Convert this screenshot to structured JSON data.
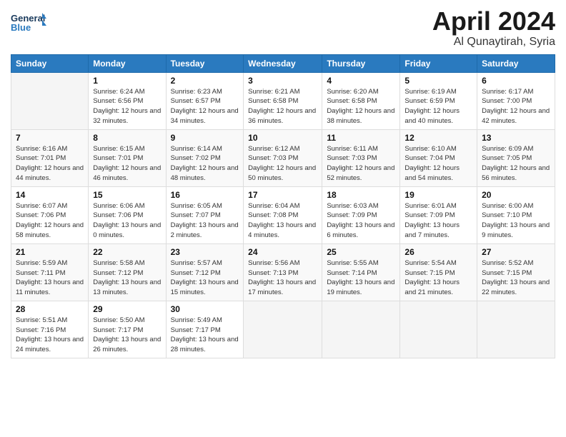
{
  "header": {
    "logo_line1": "General",
    "logo_line2": "Blue",
    "month_title": "April 2024",
    "location": "Al Qunaytirah, Syria"
  },
  "days_of_week": [
    "Sunday",
    "Monday",
    "Tuesday",
    "Wednesday",
    "Thursday",
    "Friday",
    "Saturday"
  ],
  "weeks": [
    [
      null,
      {
        "num": "1",
        "sunrise": "6:24 AM",
        "sunset": "6:56 PM",
        "daylight": "12 hours and 32 minutes."
      },
      {
        "num": "2",
        "sunrise": "6:23 AM",
        "sunset": "6:57 PM",
        "daylight": "12 hours and 34 minutes."
      },
      {
        "num": "3",
        "sunrise": "6:21 AM",
        "sunset": "6:58 PM",
        "daylight": "12 hours and 36 minutes."
      },
      {
        "num": "4",
        "sunrise": "6:20 AM",
        "sunset": "6:58 PM",
        "daylight": "12 hours and 38 minutes."
      },
      {
        "num": "5",
        "sunrise": "6:19 AM",
        "sunset": "6:59 PM",
        "daylight": "12 hours and 40 minutes."
      },
      {
        "num": "6",
        "sunrise": "6:17 AM",
        "sunset": "7:00 PM",
        "daylight": "12 hours and 42 minutes."
      }
    ],
    [
      {
        "num": "7",
        "sunrise": "6:16 AM",
        "sunset": "7:01 PM",
        "daylight": "12 hours and 44 minutes."
      },
      {
        "num": "8",
        "sunrise": "6:15 AM",
        "sunset": "7:01 PM",
        "daylight": "12 hours and 46 minutes."
      },
      {
        "num": "9",
        "sunrise": "6:14 AM",
        "sunset": "7:02 PM",
        "daylight": "12 hours and 48 minutes."
      },
      {
        "num": "10",
        "sunrise": "6:12 AM",
        "sunset": "7:03 PM",
        "daylight": "12 hours and 50 minutes."
      },
      {
        "num": "11",
        "sunrise": "6:11 AM",
        "sunset": "7:03 PM",
        "daylight": "12 hours and 52 minutes."
      },
      {
        "num": "12",
        "sunrise": "6:10 AM",
        "sunset": "7:04 PM",
        "daylight": "12 hours and 54 minutes."
      },
      {
        "num": "13",
        "sunrise": "6:09 AM",
        "sunset": "7:05 PM",
        "daylight": "12 hours and 56 minutes."
      }
    ],
    [
      {
        "num": "14",
        "sunrise": "6:07 AM",
        "sunset": "7:06 PM",
        "daylight": "12 hours and 58 minutes."
      },
      {
        "num": "15",
        "sunrise": "6:06 AM",
        "sunset": "7:06 PM",
        "daylight": "13 hours and 0 minutes."
      },
      {
        "num": "16",
        "sunrise": "6:05 AM",
        "sunset": "7:07 PM",
        "daylight": "13 hours and 2 minutes."
      },
      {
        "num": "17",
        "sunrise": "6:04 AM",
        "sunset": "7:08 PM",
        "daylight": "13 hours and 4 minutes."
      },
      {
        "num": "18",
        "sunrise": "6:03 AM",
        "sunset": "7:09 PM",
        "daylight": "13 hours and 6 minutes."
      },
      {
        "num": "19",
        "sunrise": "6:01 AM",
        "sunset": "7:09 PM",
        "daylight": "13 hours and 7 minutes."
      },
      {
        "num": "20",
        "sunrise": "6:00 AM",
        "sunset": "7:10 PM",
        "daylight": "13 hours and 9 minutes."
      }
    ],
    [
      {
        "num": "21",
        "sunrise": "5:59 AM",
        "sunset": "7:11 PM",
        "daylight": "13 hours and 11 minutes."
      },
      {
        "num": "22",
        "sunrise": "5:58 AM",
        "sunset": "7:12 PM",
        "daylight": "13 hours and 13 minutes."
      },
      {
        "num": "23",
        "sunrise": "5:57 AM",
        "sunset": "7:12 PM",
        "daylight": "13 hours and 15 minutes."
      },
      {
        "num": "24",
        "sunrise": "5:56 AM",
        "sunset": "7:13 PM",
        "daylight": "13 hours and 17 minutes."
      },
      {
        "num": "25",
        "sunrise": "5:55 AM",
        "sunset": "7:14 PM",
        "daylight": "13 hours and 19 minutes."
      },
      {
        "num": "26",
        "sunrise": "5:54 AM",
        "sunset": "7:15 PM",
        "daylight": "13 hours and 21 minutes."
      },
      {
        "num": "27",
        "sunrise": "5:52 AM",
        "sunset": "7:15 PM",
        "daylight": "13 hours and 22 minutes."
      }
    ],
    [
      {
        "num": "28",
        "sunrise": "5:51 AM",
        "sunset": "7:16 PM",
        "daylight": "13 hours and 24 minutes."
      },
      {
        "num": "29",
        "sunrise": "5:50 AM",
        "sunset": "7:17 PM",
        "daylight": "13 hours and 26 minutes."
      },
      {
        "num": "30",
        "sunrise": "5:49 AM",
        "sunset": "7:17 PM",
        "daylight": "13 hours and 28 minutes."
      },
      null,
      null,
      null,
      null
    ]
  ]
}
